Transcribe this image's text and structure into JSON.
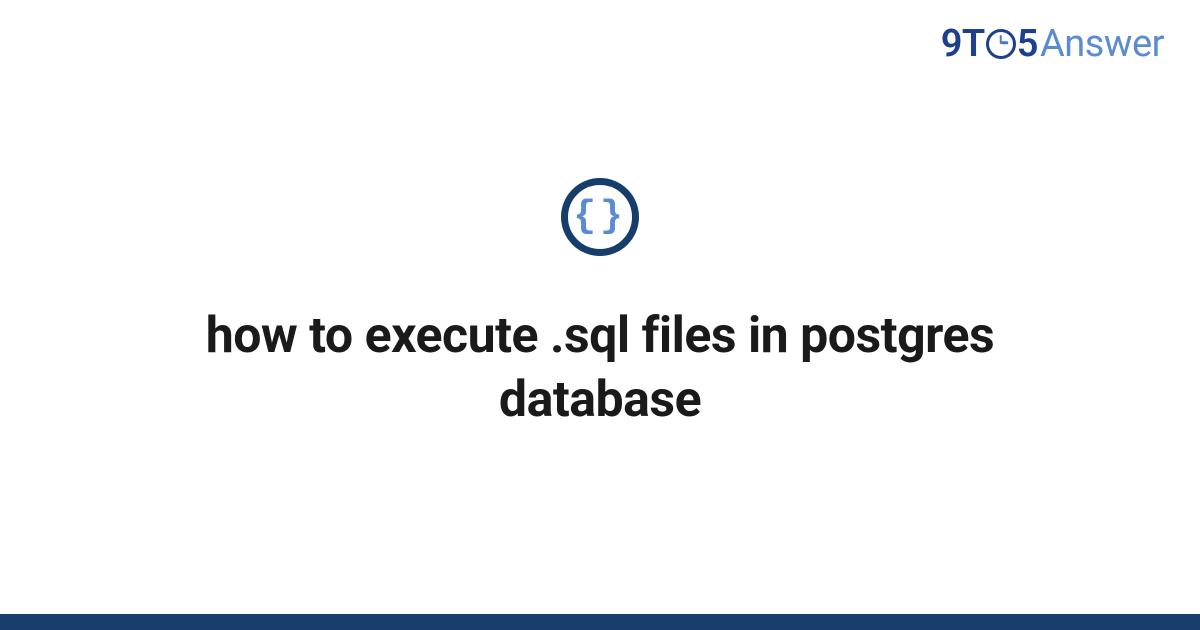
{
  "brand": {
    "part1": "9",
    "part2": "T",
    "part3": "5",
    "part4": "Answer"
  },
  "icon": {
    "left_brace": "{",
    "right_brace": "}"
  },
  "main": {
    "title": "how to execute .sql files in postgres database"
  },
  "colors": {
    "brand_dark": "#1d3f8c",
    "brand_light": "#5b8bd0",
    "icon_ring": "#163d6b",
    "footer": "#163d6b",
    "text": "#1a1a1a"
  }
}
